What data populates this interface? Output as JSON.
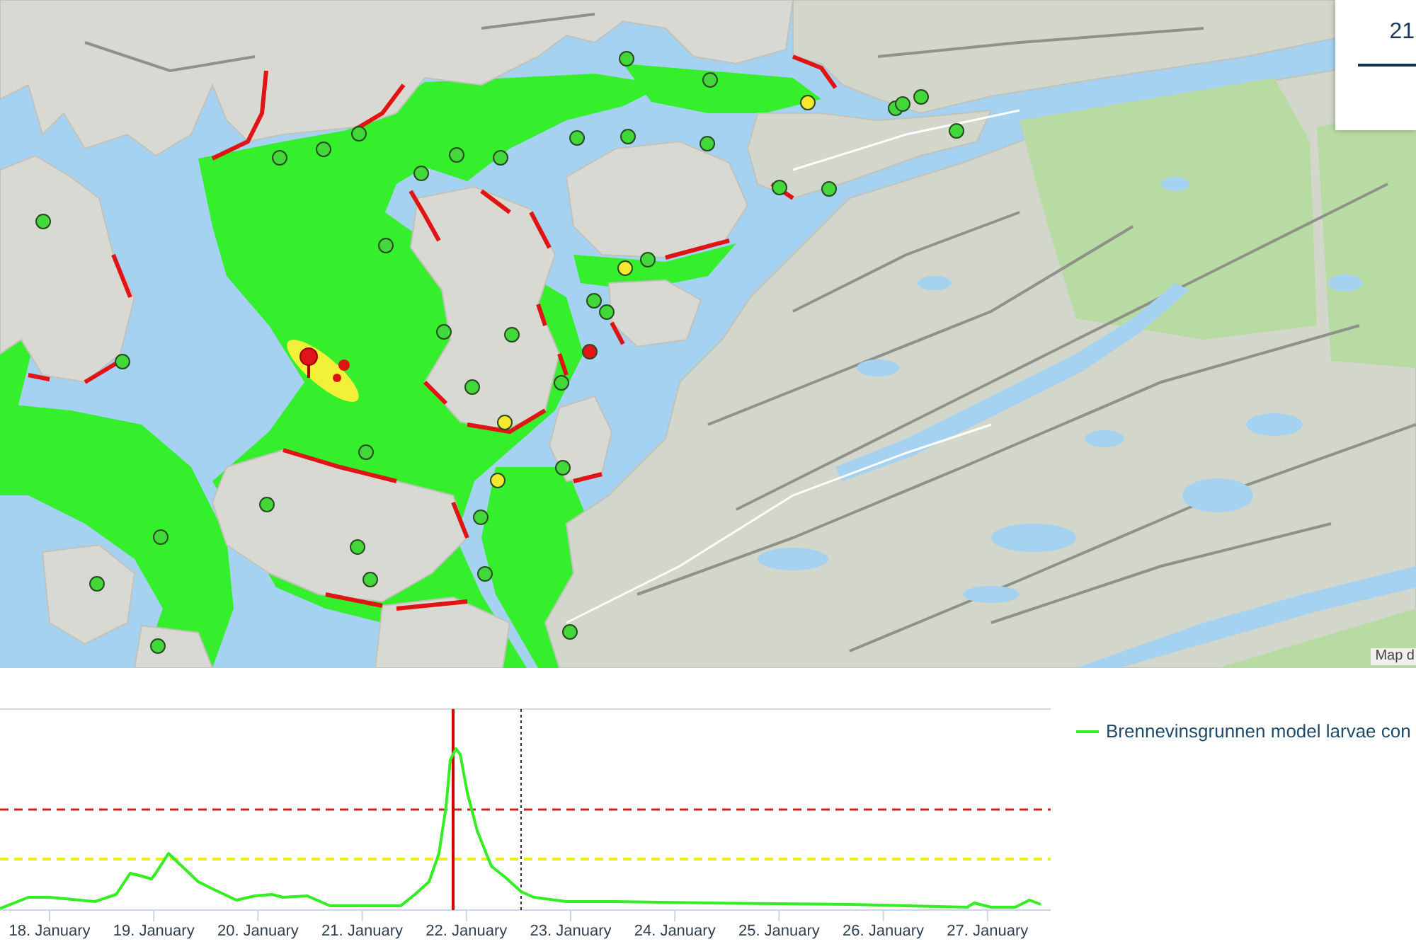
{
  "map": {
    "markers": [
      {
        "color": "#42d83a"
      },
      {
        "color": "#42d83a"
      },
      {
        "color": "#f5e82e"
      },
      {
        "color": "#42d83a"
      },
      {
        "color": "#42d83a"
      },
      {
        "color": "#42d83a"
      },
      {
        "color": "#42d83a"
      },
      {
        "color": "#42d83a"
      },
      {
        "color": "#42d83a"
      },
      {
        "color": "#42d83a"
      },
      {
        "color": "#42d83a"
      },
      {
        "color": "#42d83a"
      },
      {
        "color": "#42d83a"
      },
      {
        "color": "#42d83a"
      },
      {
        "color": "#42d83a"
      },
      {
        "color": "#42d83a"
      },
      {
        "color": "#42d83a"
      },
      {
        "color": "#42d83a"
      },
      {
        "color": "#42d83a"
      },
      {
        "color": "#42d83a"
      },
      {
        "color": "#42d83a"
      },
      {
        "color": "#f5e82e"
      },
      {
        "color": "#42d83a"
      },
      {
        "color": "#42d83a"
      },
      {
        "color": "#42d83a"
      },
      {
        "color": "#42d83a"
      },
      {
        "color": "#e3161b"
      },
      {
        "color": "#42d83a"
      },
      {
        "color": "#42d83a"
      },
      {
        "color": "#42d83a"
      },
      {
        "color": "#f5e82e"
      },
      {
        "color": "#42d83a"
      },
      {
        "color": "#f5e82e"
      },
      {
        "color": "#42d83a"
      },
      {
        "color": "#42d83a"
      },
      {
        "color": "#42d83a"
      },
      {
        "color": "#42d83a"
      },
      {
        "color": "#42d83a"
      },
      {
        "color": "#42d83a"
      },
      {
        "color": "#42d83a"
      },
      {
        "color": "#42d83a"
      },
      {
        "color": "#42d83a"
      },
      {
        "color": "#42d83a"
      }
    ],
    "attribution": "Map d"
  },
  "info_panel": {
    "value": "21"
  },
  "chart": {
    "x_labels": [
      "18. January",
      "19. January",
      "20. January",
      "21. January",
      "22. January",
      "23. January",
      "24. January",
      "25. January",
      "26. January",
      "27. January"
    ],
    "legend": [
      {
        "label": "Brennevinsgrunnen model larvae con"
      }
    ]
  }
}
